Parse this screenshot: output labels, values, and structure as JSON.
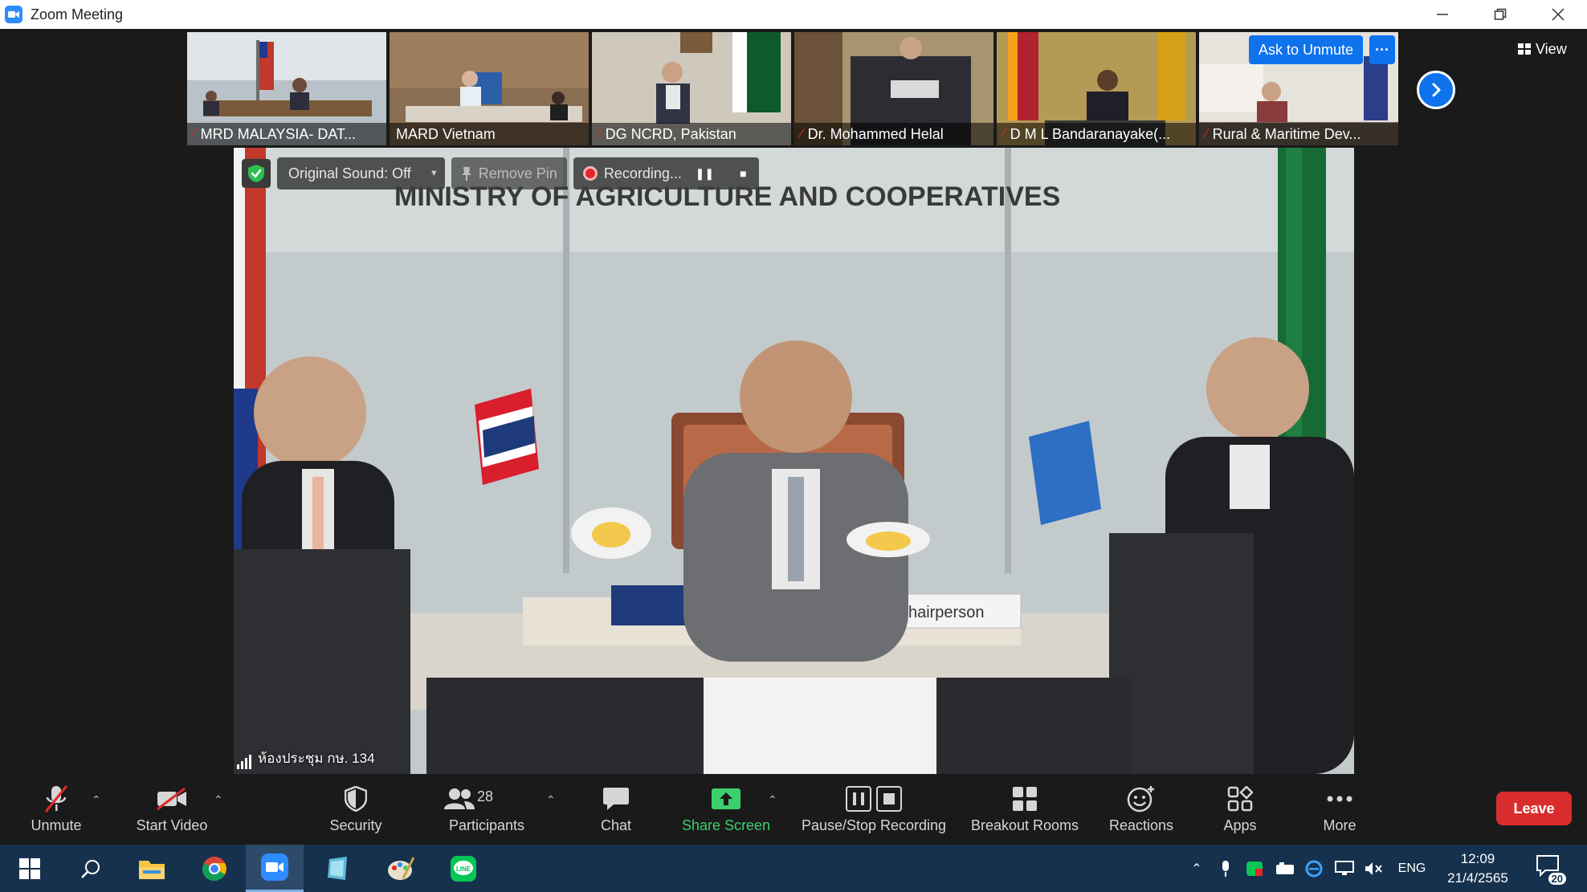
{
  "window": {
    "title": "Zoom Meeting",
    "icon": "zoom-camera-icon",
    "buttons": [
      "minimize-icon",
      "restore-icon",
      "close-icon"
    ]
  },
  "gallery": {
    "participants": [
      {
        "name": "MRD MALAYSIA- DAT...",
        "muted": true
      },
      {
        "name": "MARD Vietnam",
        "muted": false
      },
      {
        "name": "DG NCRD, Pakistan",
        "muted": true
      },
      {
        "name": "Dr. Mohammed Helal",
        "muted": true
      },
      {
        "name": "D M L Bandaranayake(...",
        "muted": true
      },
      {
        "name": "Rural & Maritime Dev...",
        "muted": true
      }
    ],
    "ask_to_unmute": "Ask to Unmute",
    "more_options": "···",
    "view_label": "View"
  },
  "speaker": {
    "original_sound": "Original Sound: Off",
    "remove_pin": "Remove Pin",
    "recording": "Recording...",
    "room_name": "ห้องประชุม กษ. 134",
    "backdrop_text": "MINISTRY OF AGRICULTURE AND COOPERATIVES",
    "nameplate": "Chairperson"
  },
  "toolbar": {
    "unmute": "Unmute",
    "start_video": "Start Video",
    "security": "Security",
    "participants": "Participants",
    "participants_count": "28",
    "chat": "Chat",
    "share_screen": "Share Screen",
    "pause_stop_recording": "Pause/Stop Recording",
    "breakout_rooms": "Breakout Rooms",
    "reactions": "Reactions",
    "apps": "Apps",
    "more": "More",
    "leave": "Leave"
  },
  "taskbar": {
    "language": "ENG",
    "time": "12:09",
    "date": "21/4/2565",
    "notification_count": "20"
  },
  "colors": {
    "zoom_blue": "#0e72ed",
    "leave_red": "#d92d2d",
    "share_green": "#3ccf6d",
    "taskbar": "#16314e"
  }
}
